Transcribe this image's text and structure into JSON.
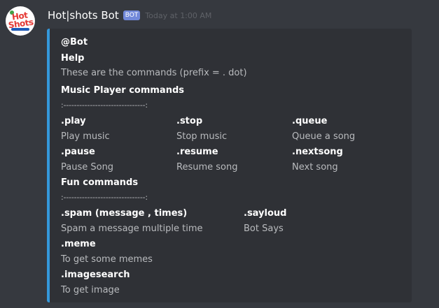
{
  "author": {
    "name": "Hot|shots Bot",
    "tag": "BOT",
    "timestamp": "Today at 1:00 AM",
    "avatar_logo": "Hot Shots"
  },
  "embed": {
    "accent_color": "#3498db",
    "mention": "@Bot",
    "title": "Help",
    "description": "These are the commands (prefix = . dot)",
    "music_section": {
      "title": "Music Player commands",
      "divider": ":-------------------------------:",
      "commands": [
        {
          "name": ".play",
          "desc": "Play music"
        },
        {
          "name": ".stop",
          "desc": "Stop music"
        },
        {
          "name": ".queue",
          "desc": "Queue a song"
        },
        {
          "name": ".pause",
          "desc": "Pause Song"
        },
        {
          "name": ".resume",
          "desc": "Resume song"
        },
        {
          "name": ".nextsong",
          "desc": "Next song"
        }
      ]
    },
    "fun_section": {
      "title": "Fun commands",
      "divider": ":-------------------------------:",
      "commands": [
        {
          "name": ".spam (message , times)",
          "desc": "Spam a message multiple time"
        },
        {
          "name": ".sayloud",
          "desc": "Bot Says"
        },
        {
          "name": ".meme",
          "desc": "To get some memes"
        },
        {
          "name": ".imagesearch",
          "desc": "To get image"
        }
      ]
    }
  }
}
